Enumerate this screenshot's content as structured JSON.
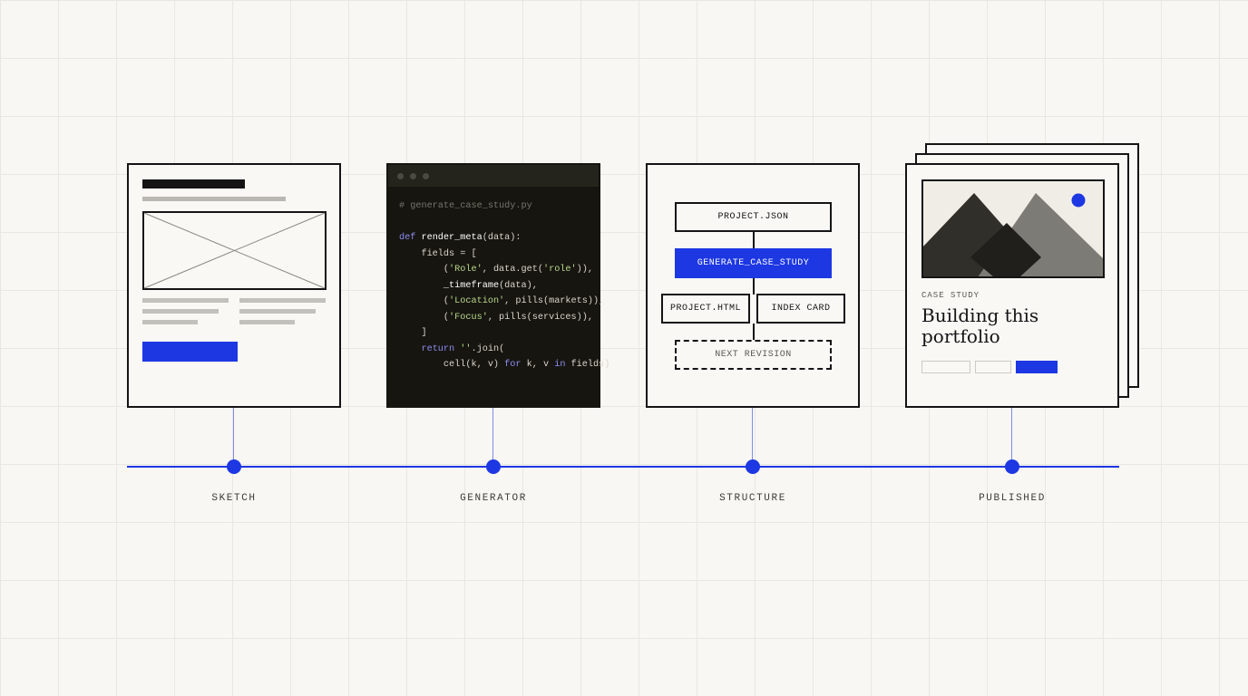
{
  "colors": {
    "accent": "#1d37e3",
    "ink": "#141414",
    "paper": "#f9f8f5",
    "code_bg": "#161510"
  },
  "stages": [
    {
      "id": "sketch",
      "label": "SKETCH"
    },
    {
      "id": "generator",
      "label": "GENERATOR"
    },
    {
      "id": "structure",
      "label": "STRUCTURE"
    },
    {
      "id": "published",
      "label": "PUBLISHED"
    }
  ],
  "code": {
    "window_dots": 3,
    "lines": [
      [
        {
          "t": "# generate_case_study.py",
          "c": "com"
        }
      ],
      [],
      [
        {
          "t": "def",
          "c": "kw"
        },
        {
          "t": " "
        },
        {
          "t": "render_meta",
          "c": "fn"
        },
        {
          "t": "(data):"
        }
      ],
      [
        {
          "t": "    fields = ["
        }
      ],
      [
        {
          "t": "        ("
        },
        {
          "t": "'Role'",
          "c": "str"
        },
        {
          "t": ", data.get("
        },
        {
          "t": "'role'",
          "c": "str"
        },
        {
          "t": ")),"
        }
      ],
      [
        {
          "t": "        "
        },
        {
          "t": "_timeframe",
          "c": "fn"
        },
        {
          "t": "(data),"
        }
      ],
      [
        {
          "t": "        ("
        },
        {
          "t": "'Location'",
          "c": "str"
        },
        {
          "t": ", pills(markets)),"
        }
      ],
      [
        {
          "t": "        ("
        },
        {
          "t": "'Focus'",
          "c": "str"
        },
        {
          "t": ", pills(services)),"
        }
      ],
      [
        {
          "t": "    ]"
        }
      ],
      [
        {
          "t": "    "
        },
        {
          "t": "return",
          "c": "kw"
        },
        {
          "t": " "
        },
        {
          "t": "''",
          "c": "str"
        },
        {
          "t": ".join("
        }
      ],
      [
        {
          "t": "        cell(k, v) "
        },
        {
          "t": "for",
          "c": "kw"
        },
        {
          "t": " k, v "
        },
        {
          "t": "in",
          "c": "kw"
        },
        {
          "t": " fields)"
        }
      ]
    ]
  },
  "structure": {
    "source": "PROJECT.JSON",
    "generator": "GENERATE_CASE_STUDY",
    "outputs": [
      "PROJECT.HTML",
      "INDEX CARD"
    ],
    "next": "NEXT REVISION"
  },
  "published": {
    "eyebrow": "CASE STUDY",
    "title_line1": "Building this",
    "title_line2": "portfolio"
  }
}
